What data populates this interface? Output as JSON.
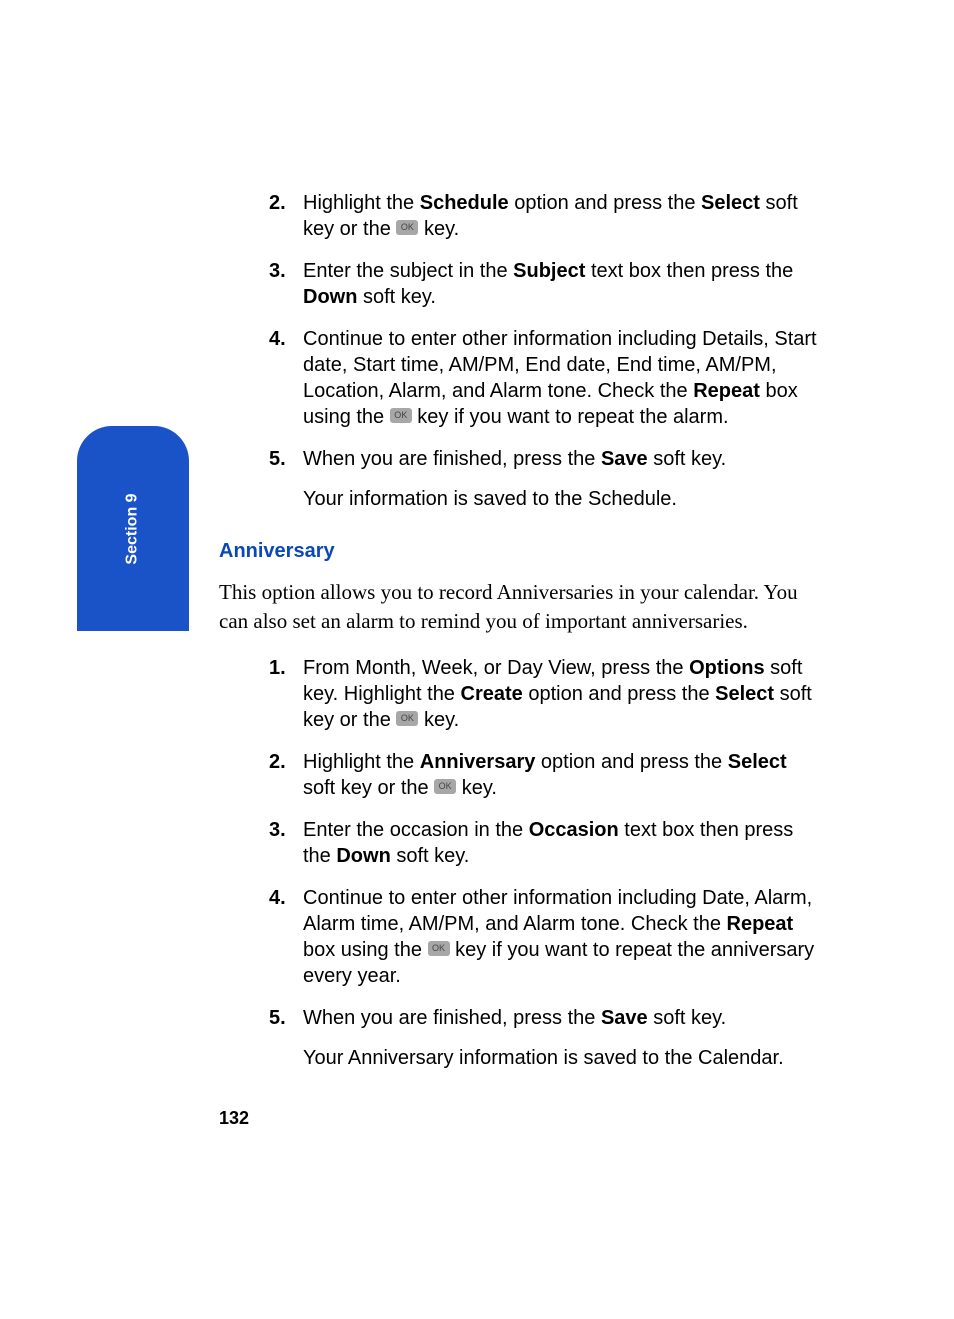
{
  "section_tab": "Section 9",
  "ok_label": "OK",
  "list_a": {
    "step2": {
      "num": "2.",
      "t1": "Highlight the ",
      "b1": "Schedule",
      "t2": " option and press the ",
      "b2": "Select",
      "t3": " soft key or the ",
      "t4": " key."
    },
    "step3": {
      "num": "3.",
      "t1": "Enter the subject in the ",
      "b1": "Subject",
      "t2": " text box then press the ",
      "b2": "Down",
      "t3": " soft key."
    },
    "step4": {
      "num": "4.",
      "t1": "Continue to enter other information including Details, Start date, Start time, AM/PM, End date, End time, AM/PM, Location, Alarm, and Alarm tone. Check the ",
      "b1": "Repeat",
      "t2": " box using the ",
      "t3": " key if you want to repeat the alarm."
    },
    "step5": {
      "num": "5.",
      "t1": "When you are finished, press the ",
      "b1": "Save",
      "t2": " soft key.",
      "sub": "Your information is saved to the Schedule."
    }
  },
  "subheading": "Anniversary",
  "body": "This option allows you to record Anniversaries in your calendar. You can also set an alarm to remind you of important anniversaries.",
  "list_b": {
    "step1": {
      "num": "1.",
      "t1": "From Month, Week, or Day View, press the ",
      "b1": "Options",
      "t2": " soft key. Highlight the ",
      "b2": "Create",
      "t3": " option and press the ",
      "b3": "Select",
      "t4": " soft key or the ",
      "t5": " key."
    },
    "step2": {
      "num": "2.",
      "t1": "Highlight the ",
      "b1": "Anniversary",
      "t2": " option and press the ",
      "b2": "Select",
      "t3": " soft key or the ",
      "t4": " key."
    },
    "step3": {
      "num": "3.",
      "t1": "Enter the occasion in the ",
      "b1": "Occasion",
      "t2": " text box then press the ",
      "b2": "Down",
      "t3": " soft key."
    },
    "step4": {
      "num": "4.",
      "t1": "Continue to enter other information including Date, Alarm, Alarm time, AM/PM, and Alarm tone. Check the ",
      "b1": "Repeat",
      "t2": " box using the ",
      "t3": " key if you want to repeat the anniversary every year."
    },
    "step5": {
      "num": "5.",
      "t1": "When you are finished, press the ",
      "b1": "Save",
      "t2": " soft key.",
      "sub": "Your Anniversary information is saved to the Calendar."
    }
  },
  "page_number": "132"
}
